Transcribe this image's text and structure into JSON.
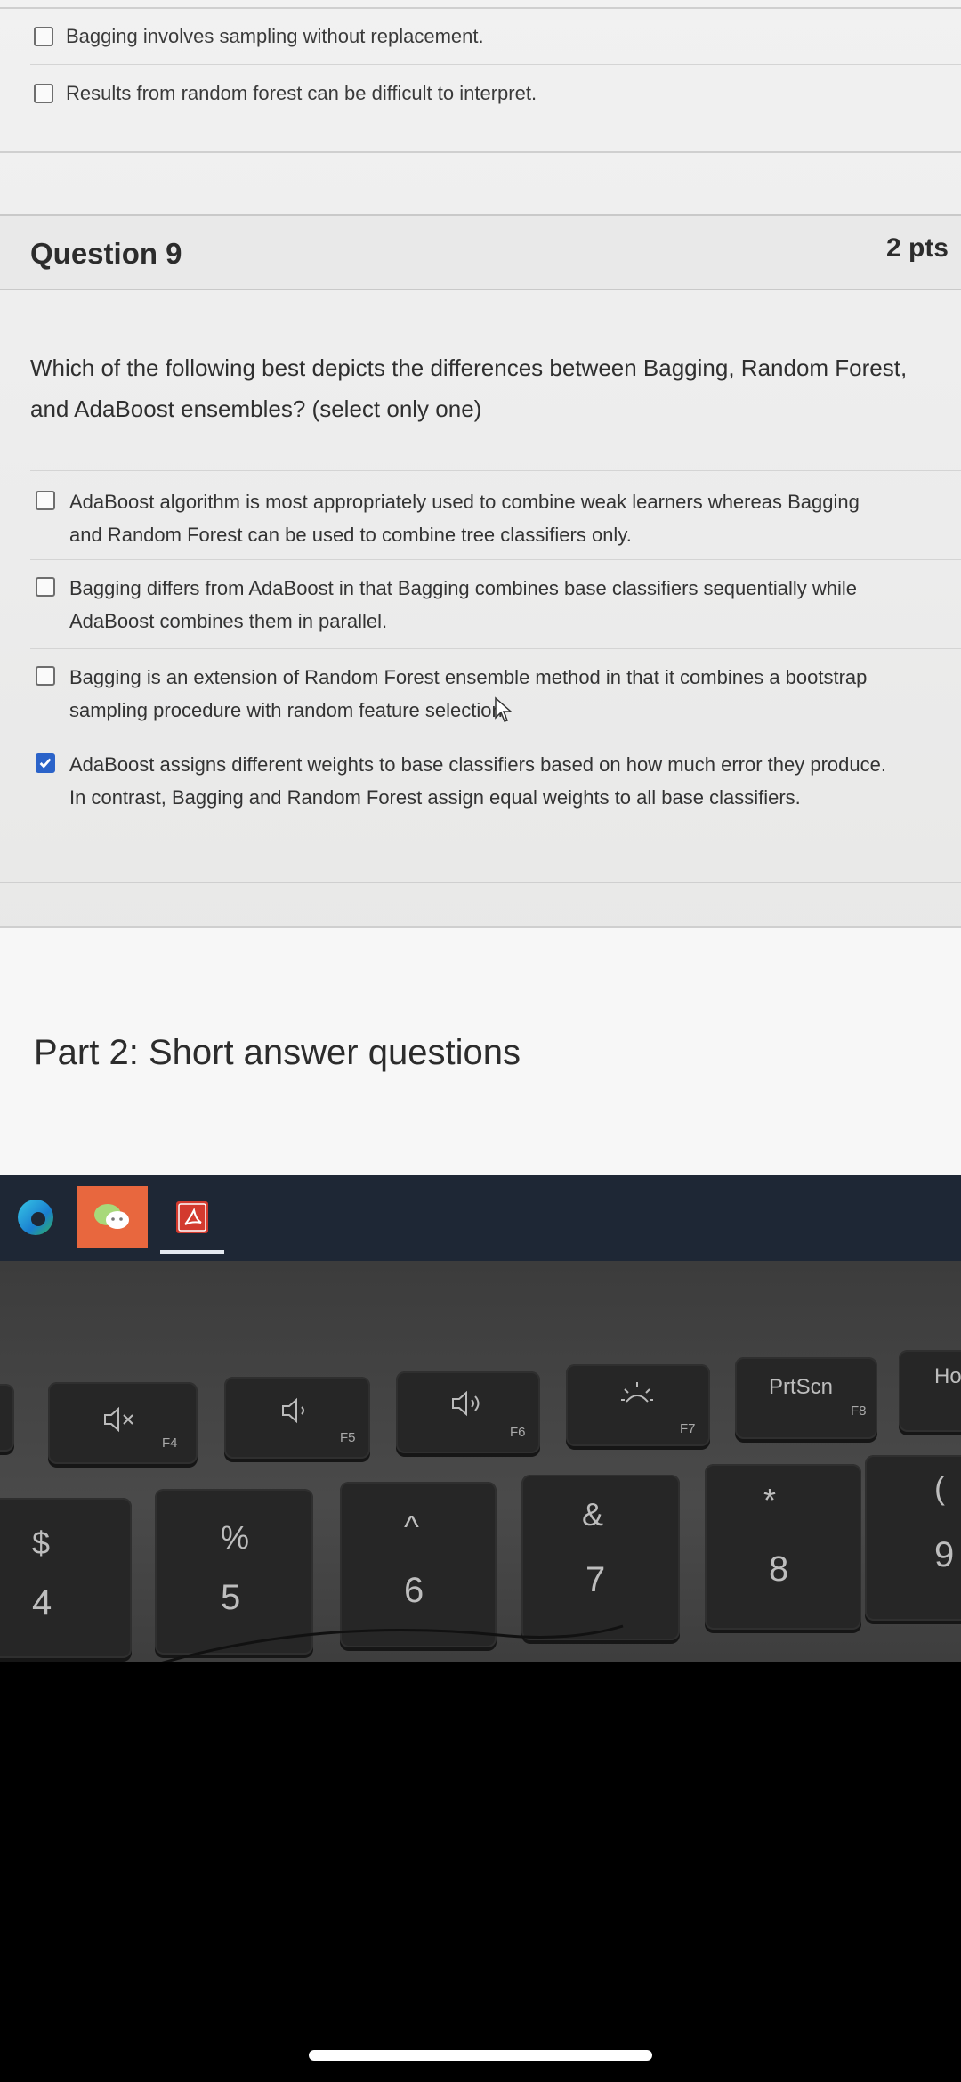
{
  "previous_question": {
    "options": [
      {
        "label": "Bagging involves sampling without replacement."
      },
      {
        "label": "Results from random forest can be difficult to interpret."
      }
    ]
  },
  "question": {
    "title": "Question 9",
    "points": "2 pts",
    "text": "Which of the following best depicts the differences between Bagging, Random Forest, and AdaBoost ensembles? (select only one)",
    "answers": [
      {
        "line1": "AdaBoost algorithm is most appropriately used to combine weak learners whereas Bagging",
        "line2": "and Random Forest can be used to combine tree classifiers only.",
        "checked": false
      },
      {
        "line1": "Bagging differs from AdaBoost in that Bagging combines base classifiers sequentially while",
        "line2": "AdaBoost combines them in parallel.",
        "checked": false
      },
      {
        "line1": "Bagging is an extension of Random Forest ensemble method in that it combines a bootstrap",
        "line2": "sampling procedure with random feature selection.",
        "checked": false
      },
      {
        "line1": "AdaBoost assigns different weights to base classifiers based on how much error they produce.",
        "line2": "In contrast, Bagging and Random Forest assign equal weights to all base classifiers.",
        "checked": true
      }
    ]
  },
  "part2": {
    "title": "Part 2: Short answer questions"
  },
  "taskbar": {
    "apps": [
      {
        "icon": "edge-icon"
      },
      {
        "icon": "wechat-icon"
      },
      {
        "icon": "acrobat-icon"
      }
    ]
  },
  "keyboard": {
    "fn_row": [
      {
        "fn": "F4",
        "icon": "mute-icon"
      },
      {
        "fn": "F5",
        "icon": "volume-down-icon"
      },
      {
        "fn": "F6",
        "icon": "volume-up-icon"
      },
      {
        "fn": "F7",
        "icon": "brightness-icon"
      },
      {
        "fn": "F8",
        "label": "PrtScn"
      },
      {
        "label": "Ho"
      }
    ],
    "num_row": [
      {
        "top": "$",
        "bottom": "4"
      },
      {
        "top": "%",
        "bottom": "5"
      },
      {
        "top": "^",
        "bottom": "6"
      },
      {
        "top": "&",
        "bottom": "7"
      },
      {
        "top": "*",
        "bottom": "8"
      },
      {
        "top": "(",
        "bottom": "9"
      }
    ]
  },
  "colors": {
    "checkbox_checked": "#2b63c9",
    "taskbar": "#1e2735",
    "wechat_tile": "#e8673e"
  }
}
